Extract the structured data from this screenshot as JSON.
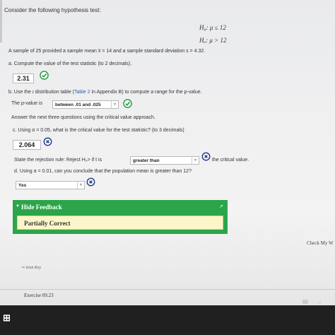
{
  "question": {
    "intro": "Consider the following hypothesis test:",
    "h0": "H₀: μ ≤ 12",
    "ha": "Hₐ: μ > 12",
    "sample_text": "A sample of 25 provided a sample mean x̄ = 14 and a sample standard deviation s = 4.32."
  },
  "part_a": {
    "prompt": "a. Compute the value of the test statistic (to 2 decimals).",
    "answer": "2.31",
    "status": "correct"
  },
  "part_b": {
    "prompt_prefix": "b. Use the ",
    "prompt_t": "t",
    "prompt_mid": " distribution table (",
    "prompt_link": "Table 2",
    "prompt_suffix": " in Appendix B) to compute a range for the p-value.",
    "pvalue_label": "The p-value is",
    "pvalue_selected": "between .01 and .025",
    "status": "correct"
  },
  "instruction": "Answer the next three questions using the critical value approach.",
  "part_c": {
    "prompt": "c. Using α = 0.05, what is the critical value for the test statistic? (to 3 decimals)",
    "answer": "2.064",
    "status": "incorrect"
  },
  "rejection_rule": {
    "prefix": "State the rejection rule: Reject H₀> if t is",
    "selected": "greater than",
    "suffix": "the critical value.",
    "status": "incorrect"
  },
  "part_d": {
    "prompt": "d. Using α = 0.01, can you conclude that the population mean is greater than 12?",
    "selected": "Yes",
    "status": "incorrect"
  },
  "feedback": {
    "toggle_label": "Hide Feedback",
    "result": "Partially Correct"
  },
  "footer": {
    "check_my_work": "Check My W",
    "icon_key": "Icon Key",
    "exercise": "Exercise 09.23"
  },
  "colors": {
    "correct": "#2e9e47",
    "incorrect": "#2a3f8f",
    "feedback_bar": "#2ca54a",
    "feedback_body": "#fbf6c9"
  }
}
